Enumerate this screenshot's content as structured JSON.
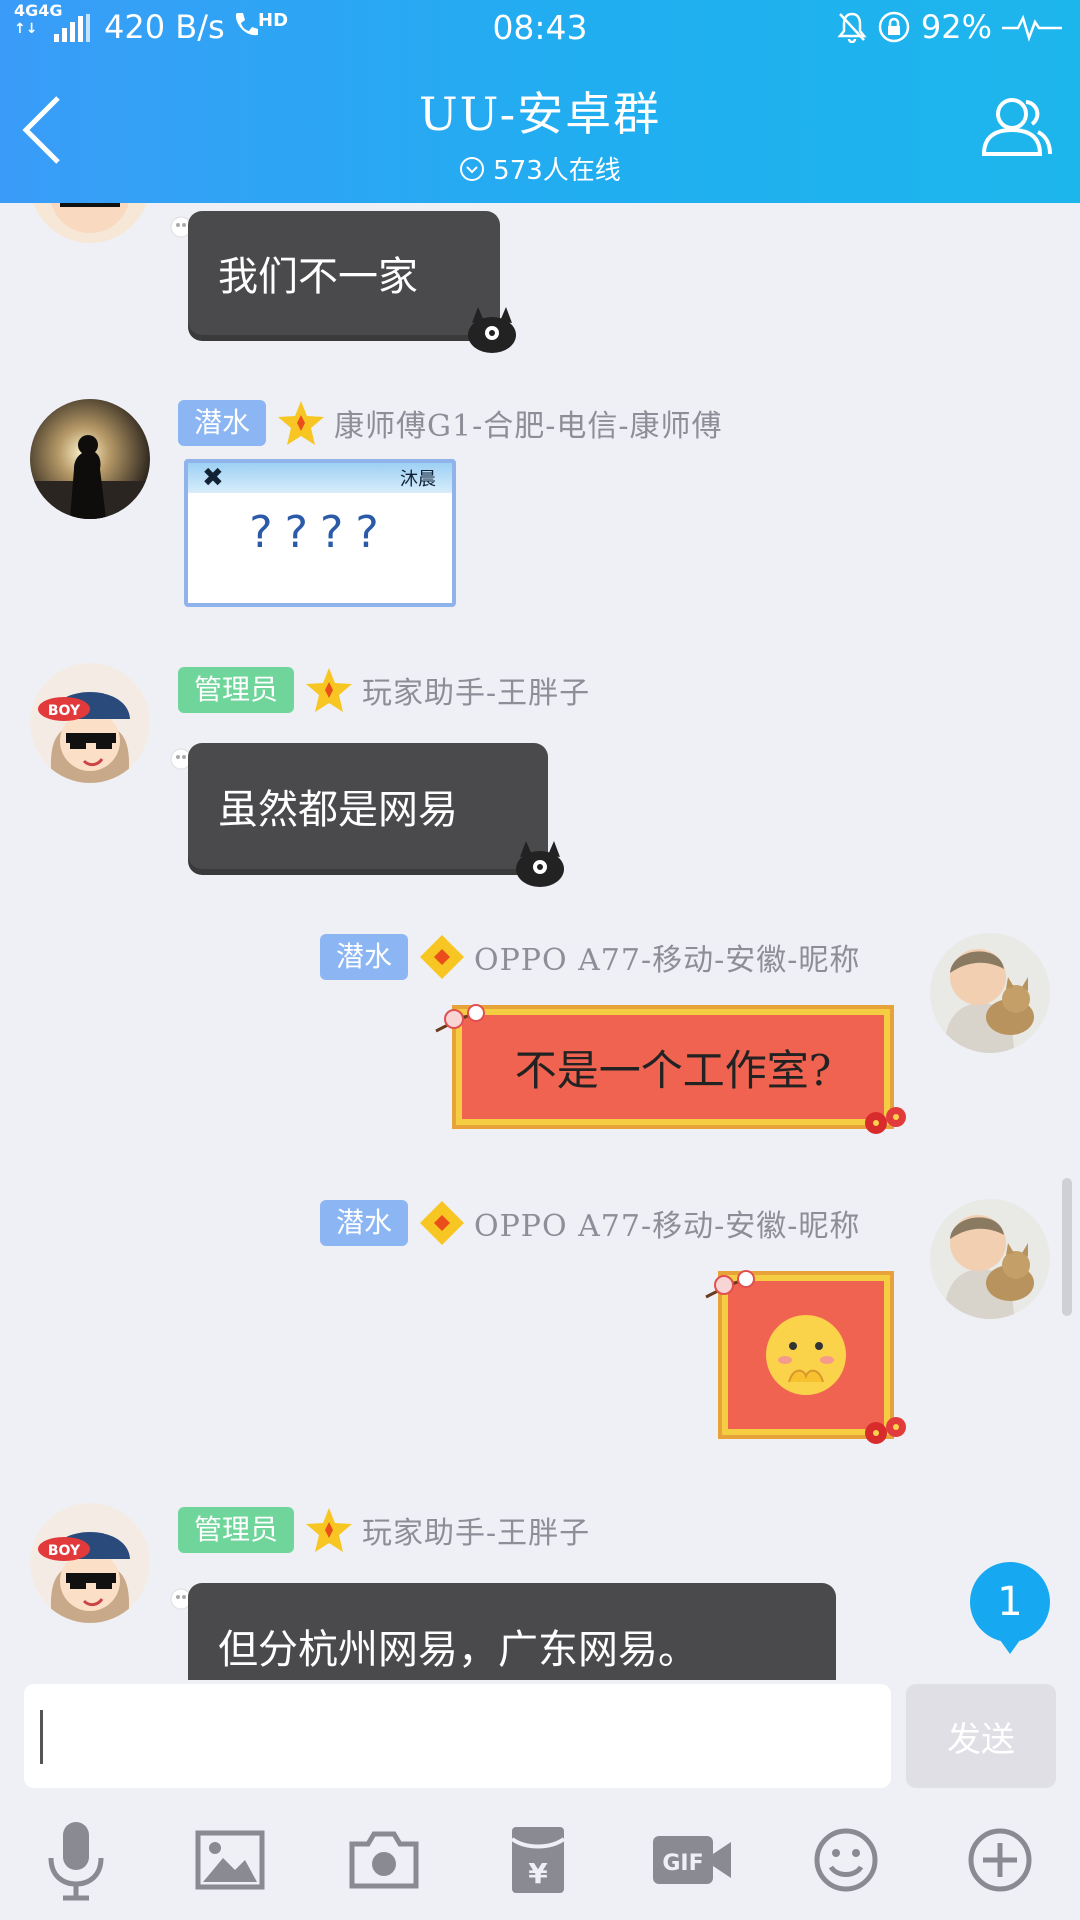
{
  "status_bar": {
    "network": "4G",
    "network2": "4G",
    "speed": "420 B/s",
    "hd": "HD",
    "time": "08:43",
    "battery": "92%"
  },
  "header": {
    "title": "UU-安卓群",
    "online": "573人在线"
  },
  "messages": [
    {
      "bubble_text": "我们不一家"
    },
    {
      "badge": "潜水",
      "sender": "康师傅G1-合肥-电信-康师傅",
      "sticker_title": "沐晨",
      "sticker_text": "????"
    },
    {
      "badge": "管理员",
      "sender": "玩家助手-王胖子",
      "bubble_text": "虽然都是网易"
    },
    {
      "badge": "潜水",
      "sender": "OPPO A77-移动-安徽-昵称",
      "bubble_text": "不是一个工作室?"
    },
    {
      "badge": "潜水",
      "sender": "OPPO A77-移动-安徽-昵称"
    },
    {
      "badge": "管理员",
      "sender": "玩家助手-王胖子",
      "bubble_text": "但分杭州网易，广东网易。"
    }
  ],
  "unread_count": "1",
  "input": {
    "placeholder": "",
    "send_label": "发送"
  },
  "toolbar": [
    "mic-icon",
    "image-icon",
    "camera-icon",
    "red-packet-icon",
    "gif-icon",
    "emoji-icon",
    "plus-icon"
  ],
  "colors": {
    "header_start": "#3a9cf8",
    "header_end": "#1db6ec",
    "badge_dive": "#8bb6f3",
    "badge_admin": "#6fd59a",
    "bg": "#eff0f6"
  }
}
